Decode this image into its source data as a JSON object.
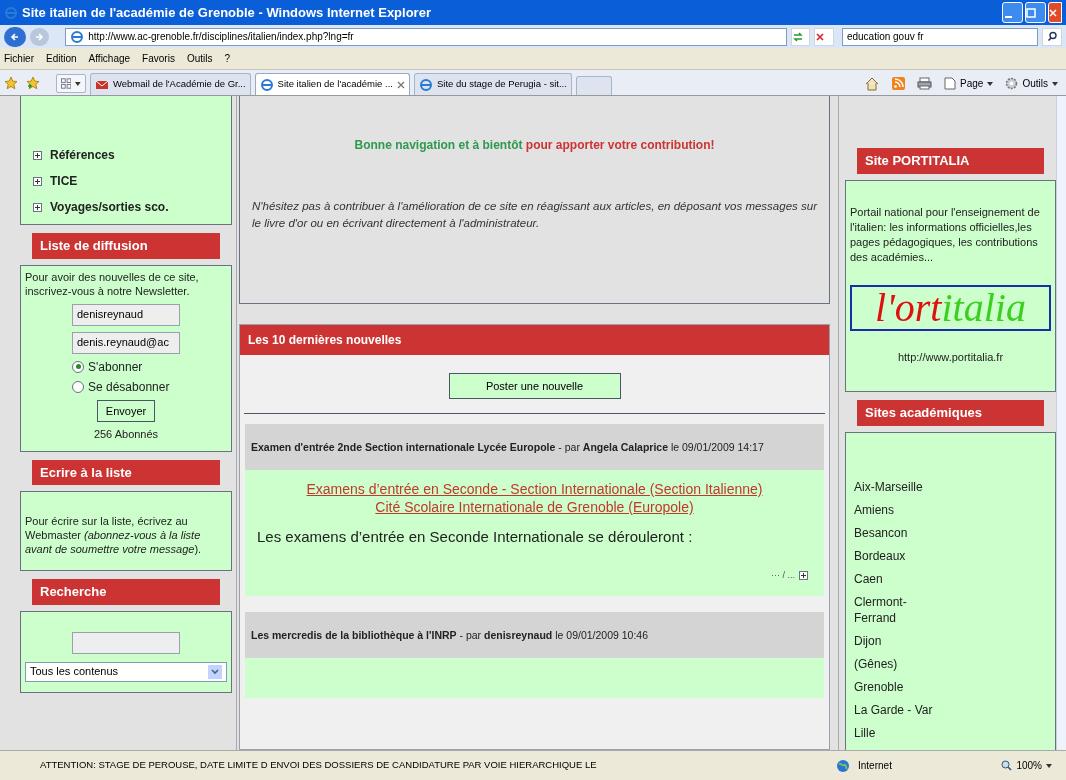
{
  "window": {
    "title": "Site italien de l'académie de Grenoble - Windows Internet Explorer"
  },
  "address_bar": {
    "url": "http://www.ac-grenoble.fr/disciplines/italien/index.php?lng=fr"
  },
  "search": {
    "value": "education gouv fr"
  },
  "menu": [
    "Fichier",
    "Edition",
    "Affichage",
    "Favoris",
    "Outils",
    "?"
  ],
  "tabs": [
    {
      "label": "Webmail de l'Académie de Gr...",
      "selected": false,
      "kind": "mail"
    },
    {
      "label": "Site italien de l'académie ...",
      "selected": true,
      "kind": "ie"
    },
    {
      "label": "Site du stage de Perugia - sit...",
      "selected": false,
      "kind": "ie"
    }
  ],
  "toolbar": [
    "Page",
    "Outils"
  ],
  "left": {
    "menu_items": [
      "Références",
      "TICE",
      "Voyages/sorties sco."
    ],
    "newsletter": {
      "title": "Liste de diffusion",
      "text": "Pour avoir des nouvelles de ce site, inscrivez-vous à notre Newsletter.",
      "name_value": "denisreynaud",
      "email_value": "denis.reynaud@ac",
      "options": [
        {
          "label": "S'abonner",
          "selected": true
        },
        {
          "label": "Se désabonner",
          "selected": false
        }
      ],
      "button": "Envoyer",
      "count": "256 Abonnés"
    },
    "write": {
      "title": "Ecrire à la liste",
      "text": "Pour écrire sur la liste, écrivez au Webmaster *(abonnez-vous à la liste avant de soumettre votre message*)."
    },
    "search": {
      "title": "Recherche",
      "select": "Tous les contenus"
    }
  },
  "welcome": {
    "green_text": "Bonne navigation et à bientôt",
    "red_text": "pour apporter votre contribution!",
    "text": "N'hésitez pas à contribuer à l'amélioration de ce site en réagissant aux articles, en déposant vos messages sur le livre d'or ou en écrivant directement à l'administrateur."
  },
  "news": {
    "title": "Les 10 dernières nouvelles",
    "post_button": "Poster une nouvelle",
    "articles": [
      {
        "header": "**Examen d'entrée 2nde Section internationale Lycée Europole** - par **Angela Calaprice** le 09/01/2009 14:17",
        "links": [
          "Examens d’entrée en Seconde - Section Internationale (Section Italienne)",
          "Cité Scolaire Internationale de Grenoble (Europole)"
        ],
        "text": "Les examens d’entrée en Seconde Internationale se dérouleront :",
        "more": "··· / ..."
      },
      {
        "header": "**Les mercredis de la bibliothèque à l'INRP** - par **denisreynaud** le 09/01/2009 10:46"
      }
    ]
  },
  "right": {
    "portitalia": {
      "title": "Site PORTITALIA",
      "text": "Portail national pour l'enseignement de l'italien: les informations officielles,les pages pédagogiques, les contributions des académies...",
      "logo_red": "l'ort",
      "logo_green": "italia",
      "url": "http://www.portitalia.fr"
    },
    "academies": {
      "title": "Sites académiques",
      "items": [
        "Aix-Marseille",
        "Amiens",
        "Besancon",
        "Bordeaux",
        "Caen",
        "Clermont-Ferrand",
        "Dijon",
        "(Gênes)",
        "Grenoble",
        "La Garde - Var",
        "Lille"
      ]
    }
  },
  "status_bar": {
    "text": "ATTENTION: STAGE DE PEROUSE, DATE LIMITE D ENVOI DES DOSSIERS DE CANDIDATURE PAR VOIE HIERARCHIQUE LE",
    "zone": "Internet",
    "zoom": "100%"
  }
}
